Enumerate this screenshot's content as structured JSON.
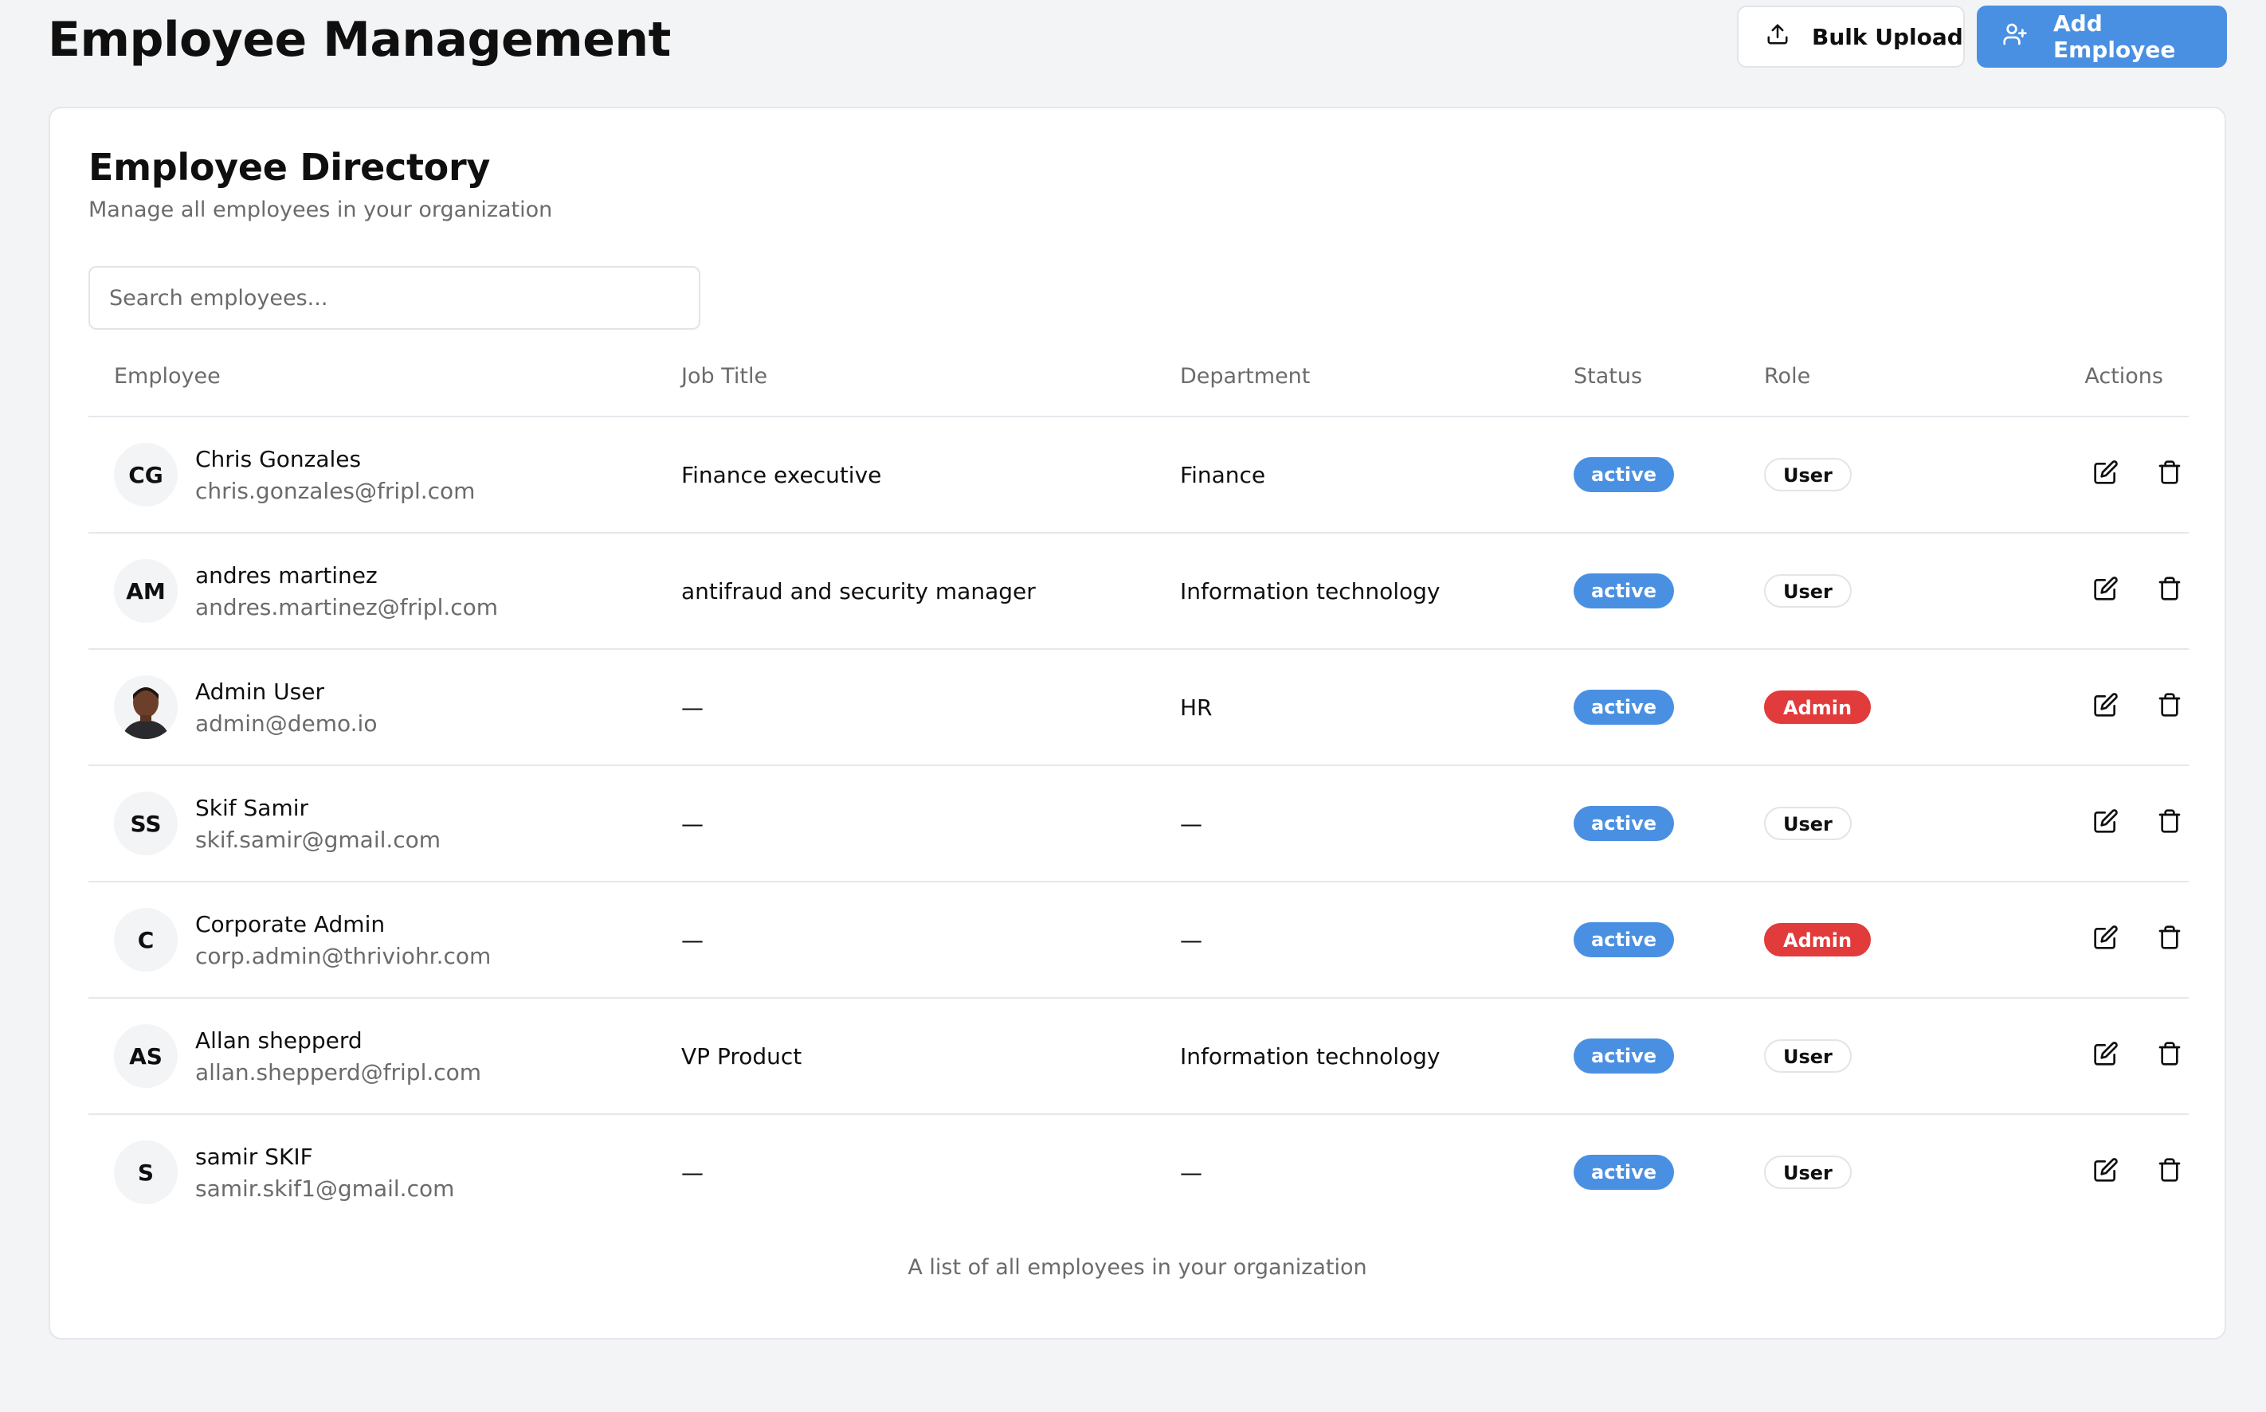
{
  "header": {
    "title": "Employee Management",
    "bulk_upload_label": "Bulk Upload",
    "add_employee_label": "Add Employee",
    "bulk_upload_icon": "upload-icon",
    "add_employee_icon": "user-plus-icon"
  },
  "colors": {
    "primary": "#4a90e2",
    "danger": "#e23b3b",
    "background": "#f3f4f6",
    "muted_text": "#6b6b6e"
  },
  "directory": {
    "title": "Employee Directory",
    "subtitle": "Manage all employees in your organization",
    "search": {
      "placeholder": "Search employees...",
      "value": ""
    },
    "columns": {
      "employee": "Employee",
      "job_title": "Job Title",
      "department": "Department",
      "status": "Status",
      "role": "Role",
      "actions": "Actions"
    },
    "rows": [
      {
        "initials": "CG",
        "photo": false,
        "name": "Chris Gonzales",
        "email": "chris.gonzales@fripl.com",
        "job_title": "Finance executive",
        "department": "Finance",
        "status": "active",
        "role": "User"
      },
      {
        "initials": "AM",
        "photo": false,
        "name": "andres martinez",
        "email": "andres.martinez@fripl.com",
        "job_title": "antifraud and security manager",
        "department": "Information technology",
        "status": "active",
        "role": "User"
      },
      {
        "initials": "",
        "photo": true,
        "name": "Admin User",
        "email": "admin@demo.io",
        "job_title": "—",
        "department": "HR",
        "status": "active",
        "role": "Admin"
      },
      {
        "initials": "SS",
        "photo": false,
        "name": "Skif Samir",
        "email": "skif.samir@gmail.com",
        "job_title": "—",
        "department": "—",
        "status": "active",
        "role": "User"
      },
      {
        "initials": "C",
        "photo": false,
        "name": "Corporate Admin",
        "email": "corp.admin@thriviohr.com",
        "job_title": "—",
        "department": "—",
        "status": "active",
        "role": "Admin"
      },
      {
        "initials": "AS",
        "photo": false,
        "name": "Allan shepperd",
        "email": "allan.shepperd@fripl.com",
        "job_title": "VP Product",
        "department": "Information technology",
        "status": "active",
        "role": "User"
      },
      {
        "initials": "S",
        "photo": false,
        "name": "samir SKIF",
        "email": "samir.skif1@gmail.com",
        "job_title": "—",
        "department": "—",
        "status": "active",
        "role": "User"
      }
    ],
    "row_actions": [
      "edit-icon",
      "trash-icon"
    ],
    "caption": "A list of all employees in your organization"
  }
}
